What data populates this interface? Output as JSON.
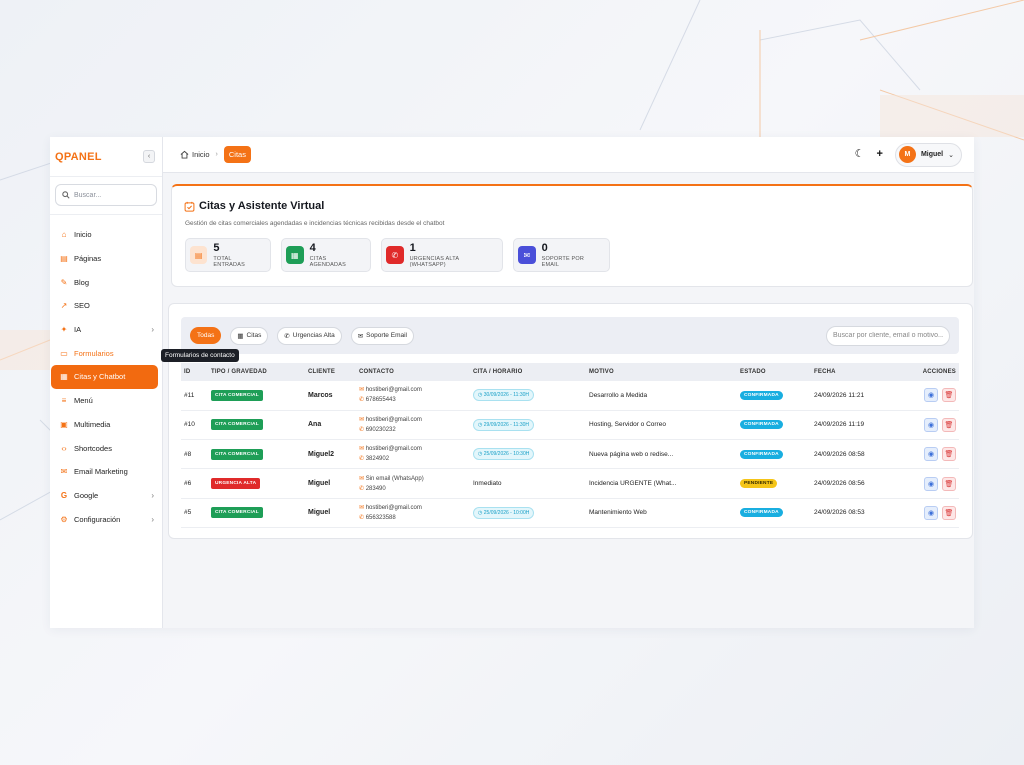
{
  "brand": {
    "name": "QPANEL"
  },
  "sidebar": {
    "search_placeholder": "Buscar...",
    "items": [
      {
        "label": "Inicio",
        "icon": "home-icon"
      },
      {
        "label": "Páginas",
        "icon": "file-icon"
      },
      {
        "label": "Blog",
        "icon": "pen-icon"
      },
      {
        "label": "SEO",
        "icon": "chart-icon"
      },
      {
        "label": "IA",
        "icon": "sparkle-icon"
      },
      {
        "label": "Formularios",
        "icon": "form-icon"
      },
      {
        "label": "Citas y Chatbot",
        "icon": "calendar-icon"
      },
      {
        "label": "Menú",
        "icon": "menu-icon"
      },
      {
        "label": "Multimedia",
        "icon": "image-icon"
      },
      {
        "label": "Shortcodes",
        "icon": "code-icon"
      },
      {
        "label": "Email Marketing",
        "icon": "mail-icon"
      },
      {
        "label": "Google",
        "icon": "google-icon"
      },
      {
        "label": "Configuración",
        "icon": "gear-icon"
      }
    ],
    "tooltip": "Formularios de contacto"
  },
  "topbar": {
    "breadcrumb_home": "Inicio",
    "breadcrumb_current": "Citas",
    "user_initial": "M",
    "user_name": "Miguel"
  },
  "header": {
    "title": "Citas y Asistente Virtual",
    "subtitle": "Gestión de citas comerciales agendadas e incidencias técnicas recibidas desde el chatbot",
    "stats": [
      {
        "value": "5",
        "label": "TOTAL ENTRADAS",
        "color": "#fde3d0"
      },
      {
        "value": "4",
        "label": "CITAS AGENDADAS",
        "color": "#1e9e57"
      },
      {
        "value": "1",
        "label": "URGENCIAS ALTA (WHATSAPP)",
        "color": "#e02a2a"
      },
      {
        "value": "0",
        "label": "SOPORTE POR EMAIL",
        "color": "#4a4fd9"
      }
    ]
  },
  "filters": {
    "chips": [
      "Todas",
      "Citas",
      "Urgencias Alta",
      "Soporte Email"
    ],
    "search_placeholder": "Buscar por cliente, email o motivo..."
  },
  "table": {
    "headers": [
      "ID",
      "TIPO / GRAVEDAD",
      "CLIENTE",
      "CONTACTO",
      "CITA / HORARIO",
      "MOTIVO",
      "ESTADO",
      "FECHA",
      "ACCIONES"
    ],
    "rows": [
      {
        "id": "#11",
        "type": "CITA COMERCIAL",
        "client": "Marcos",
        "email": "hostiberi@gmail.com",
        "phone": "678655443",
        "slot": "30/09/2026 - 11:30H",
        "reason": "Desarrollo a Medida",
        "status": "CONFIRMADA",
        "date": "24/09/2026 11:21"
      },
      {
        "id": "#10",
        "type": "CITA COMERCIAL",
        "client": "Ana",
        "email": "hostiberi@gmail.com",
        "phone": "690230232",
        "slot": "29/09/2026 - 11:30H",
        "reason": "Hosting, Servidor o Correo",
        "status": "CONFIRMADA",
        "date": "24/09/2026 11:19"
      },
      {
        "id": "#8",
        "type": "CITA COMERCIAL",
        "client": "Miguel2",
        "email": "hostiberi@gmail.com",
        "phone": "3824902",
        "slot": "25/09/2026 - 10:30H",
        "reason": "Nueva página web o redise...",
        "status": "CONFIRMADA",
        "date": "24/09/2026 08:58"
      },
      {
        "id": "#6",
        "type": "URGENCIA ALTA",
        "client": "Miguel",
        "email": "Sin email (WhatsApp)",
        "phone": "283490",
        "slot": "Inmediato",
        "reason": "Incidencia URGENTE (What...",
        "status": "PENDIENTE",
        "date": "24/09/2026 08:56"
      },
      {
        "id": "#5",
        "type": "CITA COMERCIAL",
        "client": "Miguel",
        "email": "hostiberi@gmail.com",
        "phone": "656323588",
        "slot": "25/09/2026 - 10:00H",
        "reason": "Mantenimiento Web",
        "status": "CONFIRMADA",
        "date": "24/09/2026 08:53"
      }
    ]
  }
}
